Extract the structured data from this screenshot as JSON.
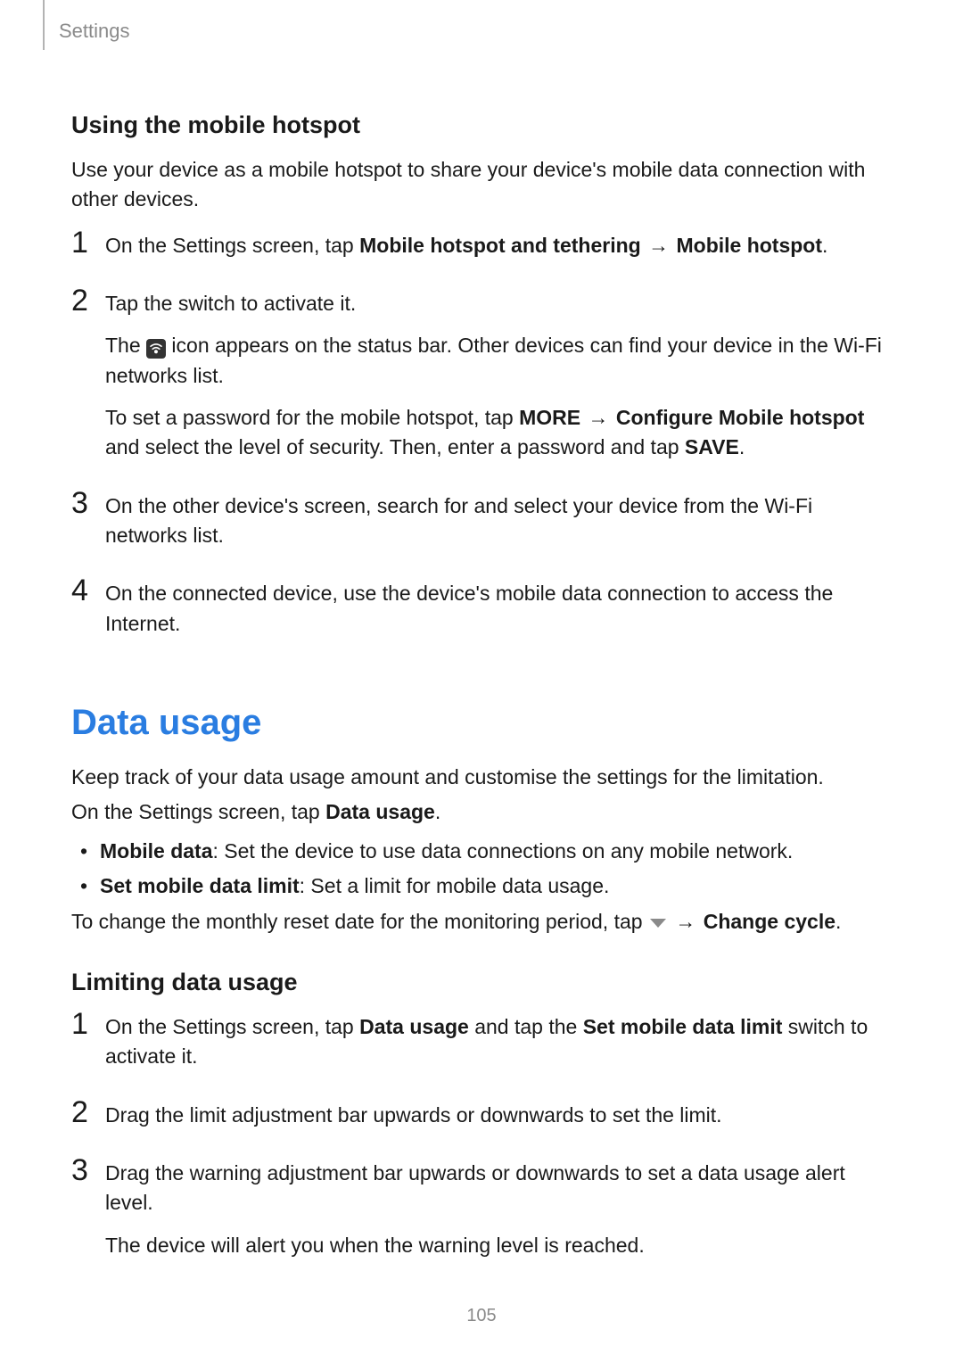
{
  "breadcrumb": "Settings",
  "page_number": "105",
  "section1": {
    "heading": "Using the mobile hotspot",
    "intro": "Use your device as a mobile hotspot to share your device's mobile data connection with other devices.",
    "steps": {
      "s1_pre": "On the Settings screen, tap ",
      "s1_b1": "Mobile hotspot and tethering",
      "s1_arrow": " → ",
      "s1_b2": "Mobile hotspot",
      "s1_post": ".",
      "s2_line1": "Tap the switch to activate it.",
      "s2_p2_pre": "The ",
      "s2_p2_post": " icon appears on the status bar. Other devices can find your device in the Wi-Fi networks list.",
      "s2_p3_pre": "To set a password for the mobile hotspot, tap ",
      "s2_p3_b1": "MORE",
      "s2_p3_arrow": " → ",
      "s2_p3_b2": "Configure Mobile hotspot",
      "s2_p3_mid": " and select the level of security. Then, enter a password and tap ",
      "s2_p3_b3": "SAVE",
      "s2_p3_post": ".",
      "s3": "On the other device's screen, search for and select your device from the Wi-Fi networks list.",
      "s4": "On the connected device, use the device's mobile data connection to access the Internet."
    }
  },
  "section2": {
    "title": "Data usage",
    "intro1": "Keep track of your data usage amount and customise the settings for the limitation.",
    "intro2_pre": "On the Settings screen, tap ",
    "intro2_b": "Data usage",
    "intro2_post": ".",
    "bullets": {
      "b1_label": "Mobile data",
      "b1_text": ": Set the device to use data connections on any mobile network.",
      "b2_label": "Set mobile data limit",
      "b2_text": ": Set a limit for mobile data usage."
    },
    "cycle_pre": "To change the monthly reset date for the monitoring period, tap ",
    "cycle_arrow": " → ",
    "cycle_b": "Change cycle",
    "cycle_post": "."
  },
  "section3": {
    "heading": "Limiting data usage",
    "steps": {
      "s1_pre": "On the Settings screen, tap ",
      "s1_b1": "Data usage",
      "s1_mid": " and tap the ",
      "s1_b2": "Set mobile data limit",
      "s1_post": " switch to activate it.",
      "s2": "Drag the limit adjustment bar upwards or downwards to set the limit.",
      "s3_p1": "Drag the warning adjustment bar upwards or downwards to set a data usage alert level.",
      "s3_p2": "The device will alert you when the warning level is reached."
    }
  }
}
